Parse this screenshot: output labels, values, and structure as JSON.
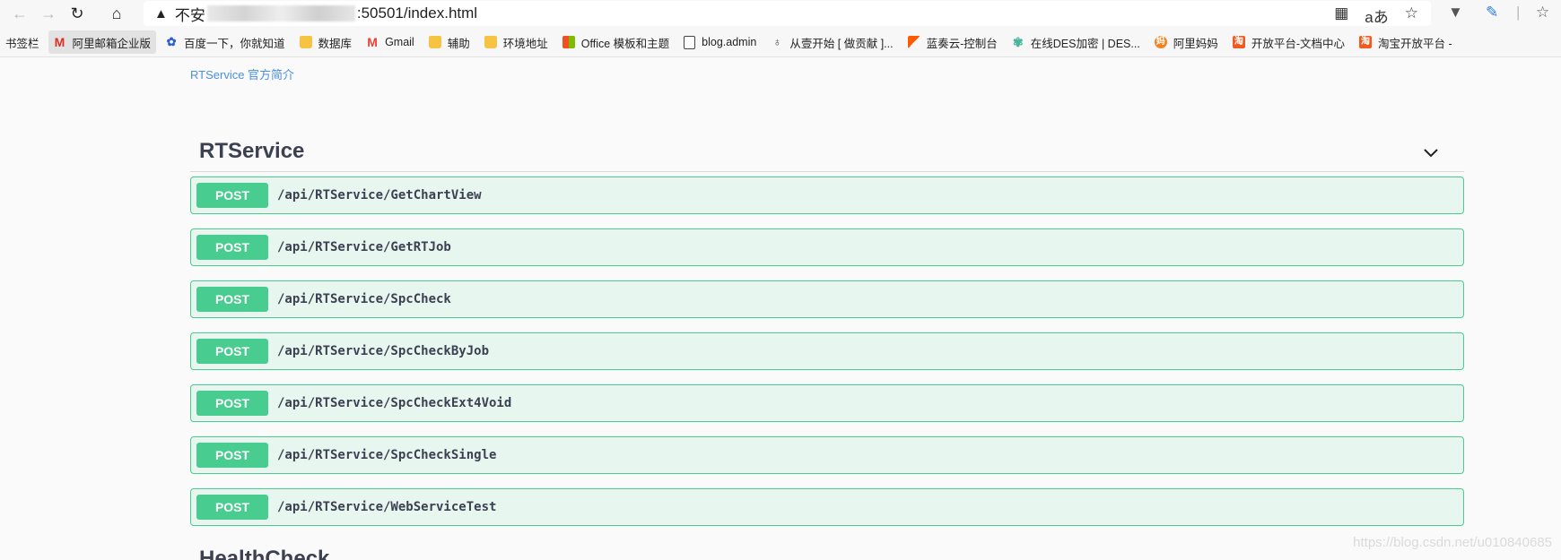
{
  "browser": {
    "address_prefix": "不安",
    "address_suffix": ":50501/index.html",
    "translate_icon_text": "aあ"
  },
  "bookmarks": [
    {
      "label": "书签栏",
      "icon": "none"
    },
    {
      "label": "阿里邮箱企业版",
      "icon": "m-logo-icon"
    },
    {
      "label": "百度一下，你就知道",
      "icon": "paw-icon"
    },
    {
      "label": "数据库",
      "icon": "folder-icon"
    },
    {
      "label": "Gmail",
      "icon": "gmail-icon"
    },
    {
      "label": "辅助",
      "icon": "folder-icon"
    },
    {
      "label": "环境地址",
      "icon": "folder-icon"
    },
    {
      "label": "Office 模板和主题",
      "icon": "microsoft-icon"
    },
    {
      "label": "blog.admin",
      "icon": "document-icon"
    },
    {
      "label": "从壹开始 [ 做贡献 ]...",
      "icon": "zero-icon"
    },
    {
      "label": "蓝奏云-控制台",
      "icon": "flag-icon"
    },
    {
      "label": "在线DES加密 | DES...",
      "icon": "flower-icon"
    },
    {
      "label": "阿里妈妈",
      "icon": "alimama-icon"
    },
    {
      "label": "开放平台-文档中心",
      "icon": "taobao-icon"
    },
    {
      "label": "淘宝开放平台 -",
      "icon": "taobao-icon"
    }
  ],
  "page": {
    "intro_link": "RTService 官方简介",
    "section_title": "RTService",
    "next_section_title": "HealthCheck",
    "watermark": "https://blog.csdn.net/u010840685"
  },
  "operations": [
    {
      "method": "POST",
      "path": "/api/RTService/GetChartView"
    },
    {
      "method": "POST",
      "path": "/api/RTService/GetRTJob"
    },
    {
      "method": "POST",
      "path": "/api/RTService/SpcCheck"
    },
    {
      "method": "POST",
      "path": "/api/RTService/SpcCheckByJob"
    },
    {
      "method": "POST",
      "path": "/api/RTService/SpcCheckExt4Void"
    },
    {
      "method": "POST",
      "path": "/api/RTService/SpcCheckSingle"
    },
    {
      "method": "POST",
      "path": "/api/RTService/WebServiceTest"
    }
  ],
  "colors": {
    "post_green": "#49cc90",
    "post_bg": "#e8f6f0",
    "link_blue": "#4990e2",
    "title_dark": "#3b4151"
  }
}
